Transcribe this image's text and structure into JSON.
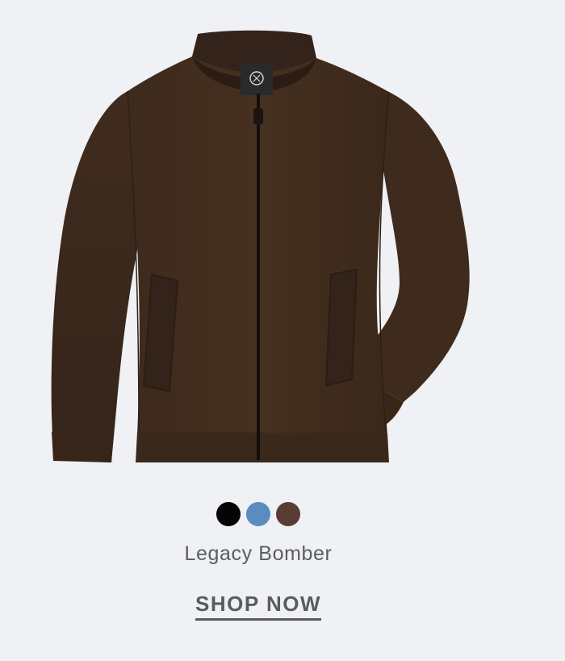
{
  "product": {
    "name": "Legacy Bomber",
    "image_icon": "brown-bomber-jacket-image",
    "swatches": [
      {
        "name": "black",
        "color": "#050505"
      },
      {
        "name": "blue",
        "color": "#5b8cc0"
      },
      {
        "name": "brown",
        "color": "#5a3d32"
      }
    ]
  },
  "cta": {
    "label": "SHOP NOW"
  }
}
